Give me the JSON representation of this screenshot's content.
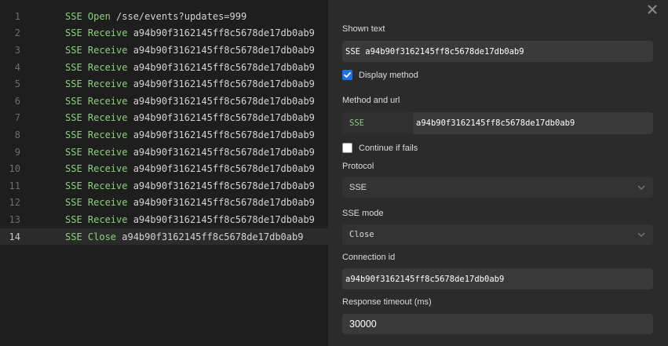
{
  "editor": {
    "lines": [
      {
        "num": "1",
        "kw": "SSE Open",
        "arg": " /sse/events?updates=999"
      },
      {
        "num": "2",
        "kw": "SSE Receive",
        "arg": " a94b90f3162145ff8c5678de17db0ab9"
      },
      {
        "num": "3",
        "kw": "SSE Receive",
        "arg": " a94b90f3162145ff8c5678de17db0ab9"
      },
      {
        "num": "4",
        "kw": "SSE Receive",
        "arg": " a94b90f3162145ff8c5678de17db0ab9"
      },
      {
        "num": "5",
        "kw": "SSE Receive",
        "arg": " a94b90f3162145ff8c5678de17db0ab9"
      },
      {
        "num": "6",
        "kw": "SSE Receive",
        "arg": " a94b90f3162145ff8c5678de17db0ab9"
      },
      {
        "num": "7",
        "kw": "SSE Receive",
        "arg": " a94b90f3162145ff8c5678de17db0ab9"
      },
      {
        "num": "8",
        "kw": "SSE Receive",
        "arg": " a94b90f3162145ff8c5678de17db0ab9"
      },
      {
        "num": "9",
        "kw": "SSE Receive",
        "arg": " a94b90f3162145ff8c5678de17db0ab9"
      },
      {
        "num": "10",
        "kw": "SSE Receive",
        "arg": " a94b90f3162145ff8c5678de17db0ab9"
      },
      {
        "num": "11",
        "kw": "SSE Receive",
        "arg": " a94b90f3162145ff8c5678de17db0ab9"
      },
      {
        "num": "12",
        "kw": "SSE Receive",
        "arg": " a94b90f3162145ff8c5678de17db0ab9"
      },
      {
        "num": "13",
        "kw": "SSE Receive",
        "arg": " a94b90f3162145ff8c5678de17db0ab9"
      },
      {
        "num": "14",
        "kw": "SSE Close",
        "arg": " a94b90f3162145ff8c5678de17db0ab9"
      }
    ],
    "active_line": "14"
  },
  "panel": {
    "close_icon": "close-icon",
    "shown_text_label": "Shown text",
    "shown_text_value": "SSE a94b90f3162145ff8c5678de17db0ab9",
    "display_method_label": "Display method",
    "display_method_checked": true,
    "method_url_label": "Method and url",
    "method_value": "SSE",
    "url_value": "a94b90f3162145ff8c5678de17db0ab9",
    "continue_if_fails_label": "Continue if fails",
    "continue_if_fails_checked": false,
    "protocol_label": "Protocol",
    "protocol_value": "SSE",
    "sse_mode_label": "SSE mode",
    "sse_mode_value": "Close",
    "connection_id_label": "Connection id",
    "connection_id_value": "a94b90f3162145ff8c5678de17db0ab9",
    "response_timeout_label": "Response timeout (ms)",
    "response_timeout_value": "30000"
  },
  "colors": {
    "keyword": "#8bd17c",
    "checkbox_accent": "#1a73e8"
  }
}
